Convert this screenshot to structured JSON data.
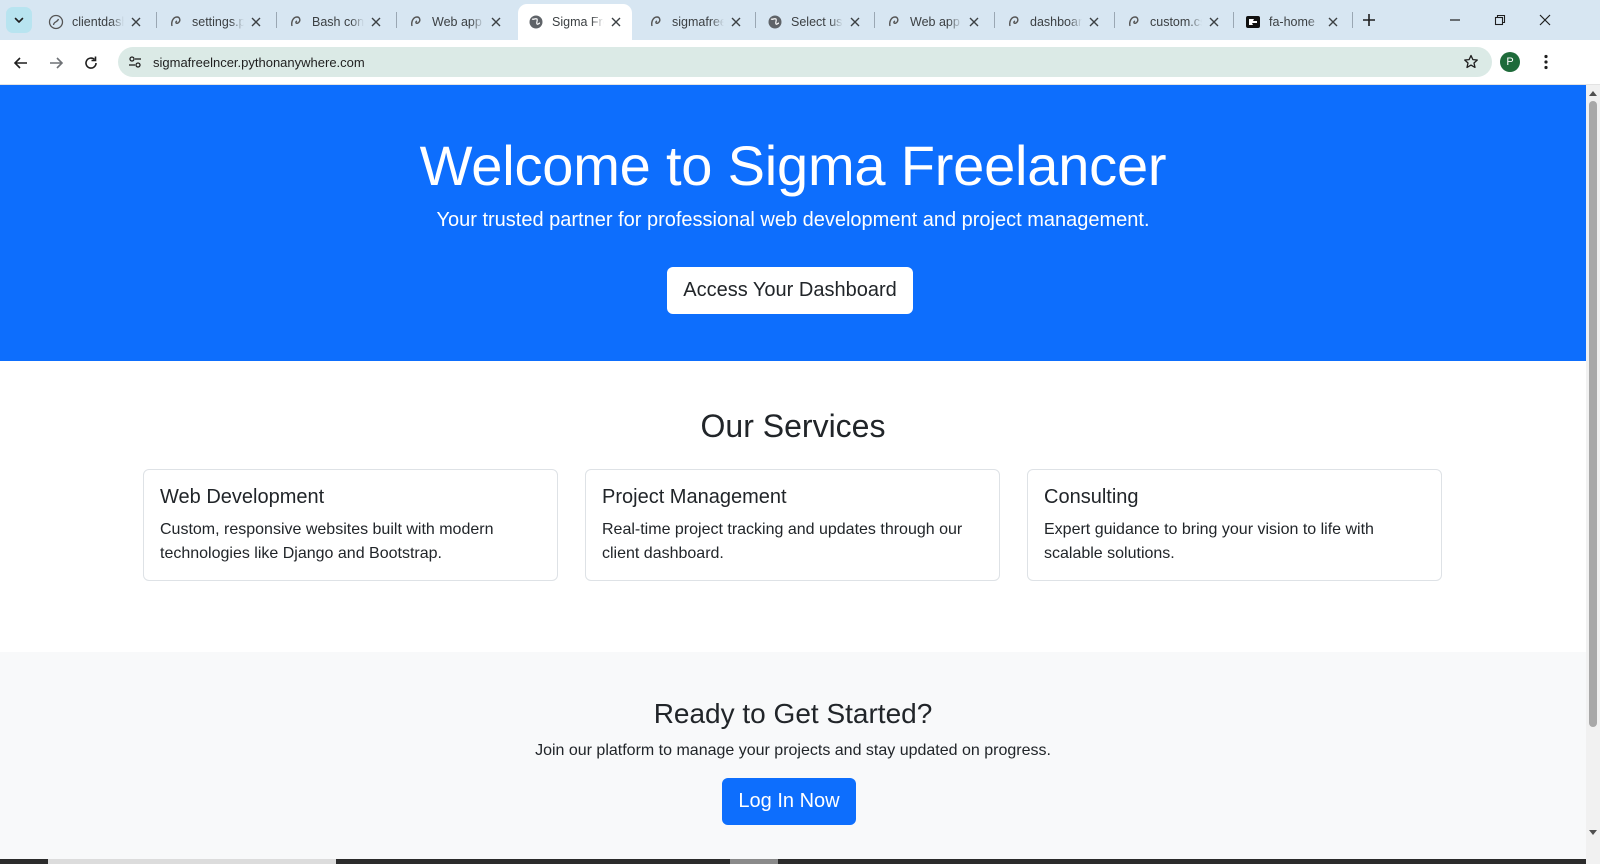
{
  "browser": {
    "tabs": [
      {
        "title": "clientdash",
        "icon": "pythonanywhere-icon"
      },
      {
        "title": "settings.p",
        "icon": "pythonanywhere-icon"
      },
      {
        "title": "Bash con",
        "icon": "pythonanywhere-icon"
      },
      {
        "title": "Web app",
        "icon": "pythonanywhere-icon"
      },
      {
        "title": "Sigma Fre",
        "icon": "globe-icon",
        "active": true
      },
      {
        "title": "sigmafree",
        "icon": "pythonanywhere-icon"
      },
      {
        "title": "Select use",
        "icon": "globe-icon"
      },
      {
        "title": "Web app",
        "icon": "pythonanywhere-icon"
      },
      {
        "title": "dashboar",
        "icon": "pythonanywhere-icon"
      },
      {
        "title": "custom.cs",
        "icon": "pythonanywhere-icon"
      },
      {
        "title": "fa-home",
        "icon": "fontawesome-icon"
      }
    ],
    "url": "sigmafreelncer.pythonanywhere.com",
    "profile_initial": "P",
    "accent_color": "#0d6efd"
  },
  "hero": {
    "title": "Welcome to Sigma Freelancer",
    "subtitle": "Your trusted partner for professional web development and project management.",
    "cta_label": "Access Your Dashboard"
  },
  "services": {
    "heading": "Our Services",
    "items": [
      {
        "title": "Web Development",
        "text": "Custom, responsive websites built with modern technologies like Django and Bootstrap."
      },
      {
        "title": "Project Management",
        "text": "Real-time project tracking and updates through our client dashboard."
      },
      {
        "title": "Consulting",
        "text": "Expert guidance to bring your vision to life with scalable solutions."
      }
    ]
  },
  "get_started": {
    "heading": "Ready to Get Started?",
    "text": "Join our platform to manage your projects and stay updated on progress.",
    "button_label": "Log In Now"
  }
}
